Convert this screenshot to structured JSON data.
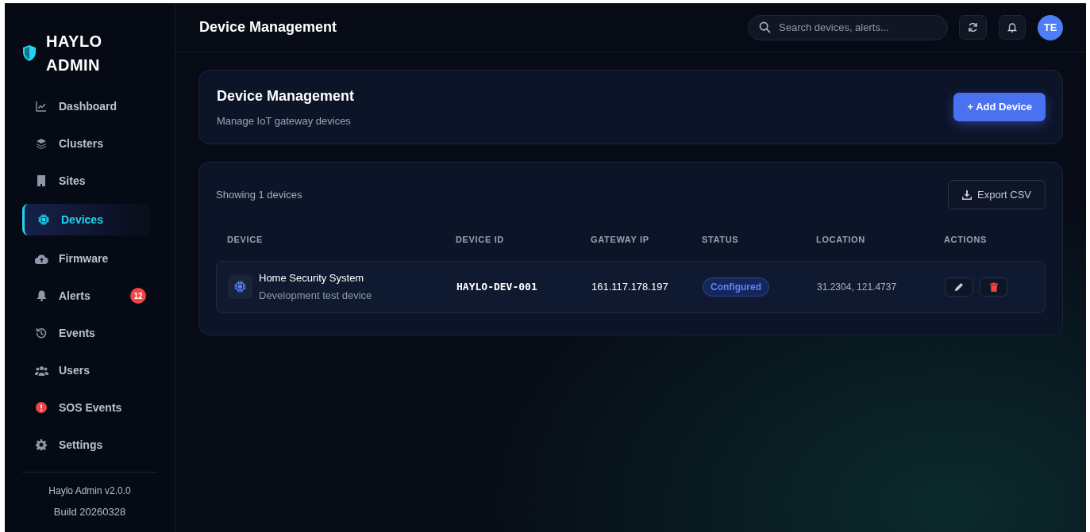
{
  "brand": {
    "line1": "HAYLO",
    "line2": "ADMIN"
  },
  "sidebar": {
    "items": [
      {
        "label": "Dashboard",
        "selected": false
      },
      {
        "label": "Clusters",
        "selected": false
      },
      {
        "label": "Sites",
        "selected": false
      },
      {
        "label": "Devices",
        "selected": true
      },
      {
        "label": "Firmware",
        "selected": false
      },
      {
        "label": "Alerts",
        "selected": false,
        "badge": "12"
      },
      {
        "label": "Events",
        "selected": false
      },
      {
        "label": "Users",
        "selected": false
      },
      {
        "label": "SOS Events",
        "selected": false
      },
      {
        "label": "Settings",
        "selected": false
      }
    ],
    "footer": {
      "version": "Haylo Admin v2.0.0",
      "build": "Build 20260328"
    }
  },
  "header": {
    "title": "Device Management",
    "search": {
      "placeholder": "Search devices, alerts..."
    },
    "avatar": "TE"
  },
  "page_card": {
    "title": "Device Management",
    "subtitle": "Manage IoT gateway devices",
    "add_button": "+ Add Device"
  },
  "table": {
    "showing": "Showing 1 devices",
    "export_button": "Export CSV",
    "columns": [
      "DEVICE",
      "DEVICE ID",
      "GATEWAY IP",
      "STATUS",
      "LOCATION",
      "ACTIONS"
    ],
    "rows": [
      {
        "name": "Home Security System",
        "description": "Development test device",
        "device_id": "HAYLO-DEV-001",
        "gateway_ip": "161.117.178.197",
        "status": "Configured",
        "location": "31.2304, 121.4737"
      }
    ]
  }
}
